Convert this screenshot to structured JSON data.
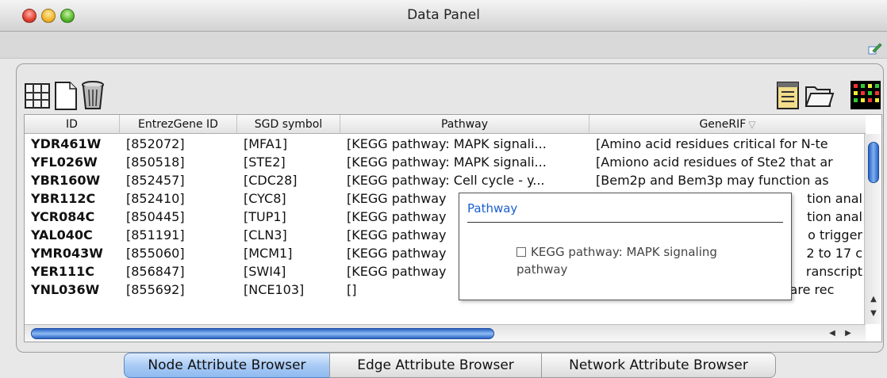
{
  "window": {
    "title": "Data Panel"
  },
  "toolbar": {
    "left_icons": [
      "table-grid-icon",
      "new-document-icon",
      "trash-icon"
    ],
    "right_icons": [
      "attribute-list-icon",
      "open-folder-icon",
      "heatmap-icon"
    ]
  },
  "table": {
    "columns": [
      "ID",
      "EntrezGene ID",
      "SGD symbol",
      "Pathway",
      "GeneRIF"
    ],
    "sort_indicator": "▽",
    "rows": [
      {
        "id": "YDR461W",
        "entrez": "[852072]",
        "sgd": "[MFA1]",
        "pathway": "[KEGG pathway: MAPK signali...",
        "generif": "[Amino acid residues critical for N-te"
      },
      {
        "id": "YFL026W",
        "entrez": "[850518]",
        "sgd": "[STE2]",
        "pathway": "[KEGG pathway: MAPK signali...",
        "generif": "[Amiono acid residues of Ste2 that ar"
      },
      {
        "id": "YBR160W",
        "entrez": "[852457]",
        "sgd": "[CDC28]",
        "pathway": "[KEGG pathway: Cell cycle - y...",
        "generif": "[Bem2p and Bem3p may function as"
      },
      {
        "id": "YBR112C",
        "entrez": "[852410]",
        "sgd": "[CYC8]",
        "pathway": "[KEGG pathway",
        "generif": "tion anal"
      },
      {
        "id": "YCR084C",
        "entrez": "[850445]",
        "sgd": "[TUP1]",
        "pathway": "[KEGG pathway",
        "generif": "tion anal"
      },
      {
        "id": "YAL040C",
        "entrez": "[851191]",
        "sgd": "[CLN3]",
        "pathway": "[KEGG pathway",
        "generif": "o trigger"
      },
      {
        "id": "YMR043W",
        "entrez": "[855060]",
        "sgd": "[MCM1]",
        "pathway": "[KEGG pathway",
        "generif": "2 to 17 c"
      },
      {
        "id": "YER111C",
        "entrez": "[856847]",
        "sgd": "[SWI4]",
        "pathway": "[KEGG pathway",
        "generif": "ranscript"
      },
      {
        "id": "YNL036W",
        "entrez": "[855692]",
        "sgd": "[NCE103]",
        "pathway": "[]",
        "generif": "[Elevated CO2 concentrations are rec"
      }
    ]
  },
  "popup": {
    "title": "Pathway",
    "item": "KEGG pathway: MAPK signaling pathway"
  },
  "tabs": [
    {
      "label": "Node Attribute Browser",
      "active": true
    },
    {
      "label": "Edge Attribute Browser",
      "active": false
    },
    {
      "label": "Network Attribute Browser",
      "active": false
    }
  ],
  "colors": {
    "accent": "#1a5fd0",
    "scroll_thumb": "#2a62c4",
    "tab_active": "#a9cbf5"
  }
}
